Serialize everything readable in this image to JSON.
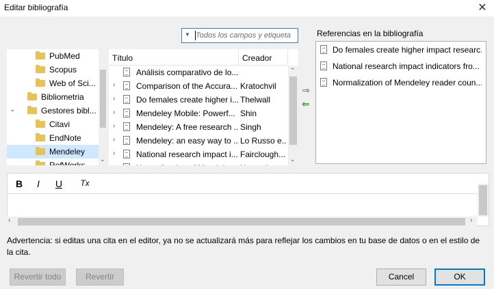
{
  "window": {
    "title": "Editar bibliografía",
    "close_glyph": "✕"
  },
  "search": {
    "placeholder": "Todos los campos y etiqueta",
    "dropdown_glyph": "▼"
  },
  "folders": [
    {
      "label": "PubMed",
      "indent": 2,
      "chevron": ""
    },
    {
      "label": "Scopus",
      "indent": 2,
      "chevron": ""
    },
    {
      "label": "Web of Sci...",
      "indent": 2,
      "chevron": ""
    },
    {
      "label": "Bibliometria",
      "indent": 1,
      "chevron": ""
    },
    {
      "label": "Gestores bibl...",
      "indent": 1,
      "chevron": "⌄"
    },
    {
      "label": "Citavi",
      "indent": 2,
      "chevron": ""
    },
    {
      "label": "EndNote",
      "indent": 2,
      "chevron": ""
    },
    {
      "label": "Mendeley",
      "indent": 2,
      "chevron": "",
      "selected": true
    },
    {
      "label": "RefWorks",
      "indent": 2,
      "chevron": ""
    }
  ],
  "items": {
    "columns": {
      "title": "Título",
      "creator": "Creador"
    },
    "rows": [
      {
        "title": "Análisis comparativo de lo...",
        "creator": "",
        "chevron": ""
      },
      {
        "title": "Comparison of the Accura...",
        "creator": "Kratochvil",
        "chevron": "›"
      },
      {
        "title": "Do females create higher i...",
        "creator": "Thelwall",
        "chevron": "›"
      },
      {
        "title": "Mendeley Mobile: Powerf...",
        "creator": "Shin",
        "chevron": "›"
      },
      {
        "title": "Mendeley: A free research ...",
        "creator": "Singh",
        "chevron": "›"
      },
      {
        "title": "Mendeley: an easy way to ...",
        "creator": "Lo Russo e...",
        "chevron": "›"
      },
      {
        "title": "National research impact i...",
        "creator": "Fairclough...",
        "chevron": "›"
      },
      {
        "title": "Normalization of Mendeley...",
        "creator": "Haustein...",
        "chevron": "›"
      }
    ]
  },
  "transfer": {
    "add_glyph": "⇒",
    "remove_glyph": "⇐"
  },
  "references": {
    "label": "Referencias en la bibliografía",
    "items": [
      "Do females create higher impact researc...",
      "National research impact indicators fro...",
      "Normalization of Mendeley reader coun..."
    ]
  },
  "editor": {
    "bold": "B",
    "italic": "I",
    "underline": "U",
    "clear": "Tx"
  },
  "warning": "Advertencia: si editas una cita en el editor, ya no se actualizará más para reflejar los cambios en tu base de datos o en el estilo de la cita.",
  "buttons": {
    "revert_all": "Revertir todo",
    "revert": "Revertir",
    "cancel": "Cancel",
    "ok": "OK"
  }
}
